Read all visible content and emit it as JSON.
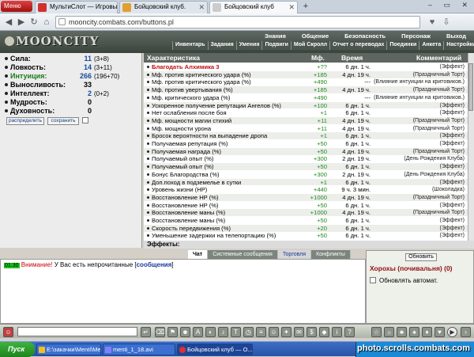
{
  "browser": {
    "menu_label": "Меню",
    "tabs": [
      {
        "label": "МультиСлот — Игровые Ав...",
        "icon_color": "#d03030",
        "active": false
      },
      {
        "label": "Бойцовский клуб.",
        "icon_color": "#e0a030",
        "active": false
      },
      {
        "label": "Бойцовский клуб",
        "icon_color": "#d0d0d0",
        "active": true
      }
    ],
    "url": "mooncity.combats.com/buttons.pl",
    "icons": [
      "back-icon",
      "forward-icon",
      "reload-icon",
      "home-icon",
      "heart-icon",
      "download-icon"
    ]
  },
  "game": {
    "logo": "MOONCITY",
    "menu_top": [
      "Знания",
      "Общение",
      "Безопасность",
      "Персонаж",
      "Выход"
    ],
    "menu_bottom": [
      "Инвентарь",
      "Задания",
      "Умения",
      "Подвиги",
      "Мой Скролл",
      "Отчет о переводах",
      "Поединки",
      "Анкета",
      "Настройки"
    ]
  },
  "stats": [
    {
      "name": "Сила:",
      "value": "11",
      "bonus": "(3+8)"
    },
    {
      "name": "Ловкость:",
      "value": "14",
      "bonus": "(3+11)"
    },
    {
      "name": "Интуиция:",
      "value": "266",
      "bonus": "(196+70)",
      "highlight": true
    },
    {
      "name": "Выносливость:",
      "value": "33",
      "bonus": ""
    },
    {
      "name": "Интеллект:",
      "value": "2",
      "bonus": "(0+2)"
    },
    {
      "name": "Мудрость:",
      "value": "0",
      "bonus": ""
    },
    {
      "name": "Духовность:",
      "value": "0",
      "bonus": ""
    }
  ],
  "stat_buttons": {
    "distribute": "распределить",
    "save": "сохранить"
  },
  "table": {
    "headers": [
      "Характеристика",
      "Мф.",
      "Время",
      "Комментарий"
    ],
    "rows": [
      {
        "name": "Благодать Алхимика 3",
        "mf": "+??",
        "time": "6 дн. 1 ч.",
        "comment": "(Эффект)",
        "red": true
      },
      {
        "name": "Мф. против критического удара (%)",
        "mf": "+185",
        "time": "4 дн. 19 ч.",
        "comment": "(Праздничный Торт)"
      },
      {
        "name": "Мф. против критического удара (%)",
        "mf": "+490",
        "time": "---",
        "comment": "(Влияние интуиции на критовиков.)"
      },
      {
        "name": "Мф. против увертывания (%)",
        "mf": "+185",
        "time": "4 дн. 19 ч.",
        "comment": "(Праздничный Торт)"
      },
      {
        "name": "Мф. критического удара (%)",
        "mf": "+490",
        "time": "---",
        "comment": "(Влияние интуиции на критовиков.)"
      },
      {
        "name": "Ускоренное получение репутации Ангелов (%)",
        "mf": "+100",
        "time": "6 дн. 1 ч.",
        "comment": "(Эффект)"
      },
      {
        "name": "Нет ослабления после боя",
        "mf": "+1",
        "time": "6 дн. 1 ч.",
        "comment": "(Эффект)"
      },
      {
        "name": "Мф. мощности магии стихий",
        "mf": "+11",
        "time": "4 дн. 19 ч.",
        "comment": "(Праздничный Торт)"
      },
      {
        "name": "Мф. мощности урона",
        "mf": "+11",
        "time": "4 дн. 19 ч.",
        "comment": "(Праздничный Торт)"
      },
      {
        "name": "Бросок вероятности на выпадение дропа",
        "mf": "+1",
        "time": "6 дн. 1 ч.",
        "comment": "(Эффект)"
      },
      {
        "name": "Получаемая репутация (%)",
        "mf": "+50",
        "time": "6 дн. 1 ч.",
        "comment": "(Эффект)"
      },
      {
        "name": "Получаемая награда (%)",
        "mf": "+50",
        "time": "4 дн. 19 ч.",
        "comment": "(Праздничный Торт)"
      },
      {
        "name": "Получаемый опыт (%)",
        "mf": "+300",
        "time": "2 дн. 19 ч.",
        "comment": "(День Рождения Клуба)"
      },
      {
        "name": "Получаемый опыт (%)",
        "mf": "+50",
        "time": "6 дн. 1 ч.",
        "comment": "(Эффект)"
      },
      {
        "name": "Бонус Благородства (%)",
        "mf": "+300",
        "time": "2 дн. 19 ч.",
        "comment": "(День Рождения Клуба)"
      },
      {
        "name": "Доп.поход в подземелье в сутки",
        "mf": "+1",
        "time": "6 дн. 1 ч.",
        "comment": "(Эффект)"
      },
      {
        "name": "Уровень жизни (HP)",
        "mf": "+440",
        "time": "9 ч. 3 мин.",
        "comment": "(Шоколадка)"
      },
      {
        "name": "Восстановление HP (%)",
        "mf": "+1000",
        "time": "4 дн. 19 ч.",
        "comment": "(Праздничный Торт)"
      },
      {
        "name": "Восстановление HP (%)",
        "mf": "+50",
        "time": "6 дн. 1 ч.",
        "comment": "(Эффект)"
      },
      {
        "name": "Восстановление маны (%)",
        "mf": "+1000",
        "time": "4 дн. 19 ч.",
        "comment": "(Праздничный Торт)"
      },
      {
        "name": "Восстановление маны (%)",
        "mf": "+50",
        "time": "6 дн. 1 ч.",
        "comment": "(Эффект)"
      },
      {
        "name": "Скорость передвижения (%)",
        "mf": "+20",
        "time": "6 дн. 1 ч.",
        "comment": "(Эффект)"
      },
      {
        "name": "Уменьшение задержки на телепортацию (%)",
        "mf": "+50",
        "time": "6 дн. 1 ч.",
        "comment": "(Эффект)"
      }
    ]
  },
  "effects_label": "Эффекты:",
  "chat": {
    "tabs": [
      "Чат",
      "Системные сообщения",
      "Торговля",
      "Конфликты"
    ],
    "time": "01:30",
    "warning": "Внимание!",
    "message": " У Вас есть непрочитанные [",
    "link": "сообщения",
    "message_end": "]"
  },
  "online": {
    "refresh": "Обновить",
    "location": "Хорохы (почивальня) (0)",
    "auto_label": "Обновлять автомат."
  },
  "taskbar": {
    "start": "Пуск",
    "items": [
      "E:\\закачки\\Menti\\Menti-1",
      "menti_1_18.avi",
      "Бойцовский клуб — О..."
    ],
    "watermark": "photo.scrolls.combats.com"
  }
}
